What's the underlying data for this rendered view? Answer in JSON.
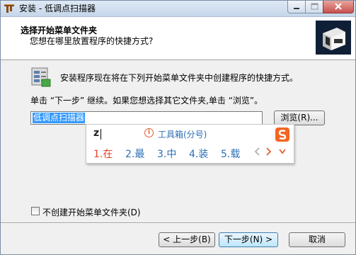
{
  "window": {
    "title": "安装 - 低调点扫描器"
  },
  "header": {
    "title": "选择开始菜单文件夹",
    "subtitle": "您想在哪里放置程序的快捷方式?"
  },
  "main": {
    "description": "安装程序现在将在下列开始菜单文件夹中创建程序的快捷方式。",
    "instruction": "单击 “下一步” 继续。如果您想选择其它文件夹,单击 “浏览”。",
    "folder_value": "低调点扫描器",
    "browse_label": "浏览(R)...",
    "no_folder_label": "不创建开始菜单文件夹(D)"
  },
  "ime": {
    "input": "z",
    "hint": "工具箱(分号)",
    "candidates": [
      "1.在",
      "2.最",
      "3.中",
      "4.装",
      "5.载"
    ]
  },
  "buttons": {
    "back": "< 上一步(B)",
    "next": "下一步(N) >",
    "cancel": "取消"
  },
  "icons": {
    "app": "installer-app-icon",
    "header_logo": "scanner-logo-icon",
    "content": "start-menu-folder-icon",
    "ime_logo": "sogou-s-logo-icon",
    "ime_hint": "info-circle-icon"
  },
  "colors": {
    "selection": "#3399ff",
    "ime_candidate": "#2d6fb5",
    "ime_first_candidate": "#e0452a",
    "ime_logo": "#f26522"
  }
}
